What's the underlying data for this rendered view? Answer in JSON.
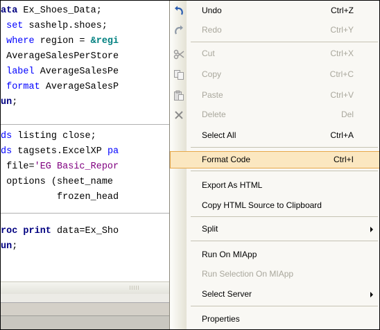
{
  "editor": {
    "lines": [
      [
        {
          "t": "ata",
          "c": "kwb"
        },
        {
          "t": " Ex_Shoes_Data;",
          "c": "plain"
        }
      ],
      [
        {
          "t": " set",
          "c": "kw"
        },
        {
          "t": " sashelp.shoes;",
          "c": "plain"
        }
      ],
      [
        {
          "t": " where",
          "c": "kw"
        },
        {
          "t": " region = ",
          "c": "plain"
        },
        {
          "t": "&regi",
          "c": "mac"
        }
      ],
      [
        {
          "t": " AverageSalesPerStore",
          "c": "plain"
        }
      ],
      [
        {
          "t": " label",
          "c": "kw"
        },
        {
          "t": " AverageSalesPe",
          "c": "plain"
        }
      ],
      [
        {
          "t": " format",
          "c": "kw"
        },
        {
          "t": " AverageSalesP",
          "c": "plain"
        }
      ],
      [
        {
          "t": "un",
          "c": "kwb"
        },
        {
          "t": ";",
          "c": "plain"
        }
      ],
      [
        {
          "t": "ds",
          "c": "kw"
        },
        {
          "t": " listing close;",
          "c": "plain"
        }
      ],
      [
        {
          "t": "ds",
          "c": "kw"
        },
        {
          "t": " tagsets.ExcelXP ",
          "c": "plain"
        },
        {
          "t": "pa",
          "c": "kw"
        }
      ],
      [
        {
          "t": " file=",
          "c": "plain"
        },
        {
          "t": "'EG Basic_Repor",
          "c": "str"
        }
      ],
      [
        {
          "t": " options (sheet_name ",
          "c": "plain"
        }
      ],
      [
        {
          "t": "          frozen_head",
          "c": "plain"
        }
      ],
      [
        {
          "t": "roc print",
          "c": "kwb"
        },
        {
          "t": " data=Ex_Sho",
          "c": "plain"
        }
      ],
      [
        {
          "t": "un",
          "c": "kwb"
        },
        {
          "t": ";",
          "c": "plain"
        }
      ]
    ]
  },
  "menu": {
    "items": [
      {
        "label": "Undo",
        "shortcut": "Ctrl+Z",
        "enabled": true,
        "icon": "undo-icon"
      },
      {
        "label": "Redo",
        "shortcut": "Ctrl+Y",
        "enabled": false,
        "icon": "redo-icon"
      },
      {
        "label": "Cut",
        "shortcut": "Ctrl+X",
        "enabled": false,
        "icon": "scissors-icon"
      },
      {
        "label": "Copy",
        "shortcut": "Ctrl+C",
        "enabled": false,
        "icon": "copy-icon"
      },
      {
        "label": "Paste",
        "shortcut": "Ctrl+V",
        "enabled": false,
        "icon": "paste-icon"
      },
      {
        "label": "Delete",
        "shortcut": "Del",
        "enabled": false,
        "icon": "delete-icon"
      },
      {
        "label": "Select All",
        "shortcut": "Ctrl+A",
        "enabled": true
      },
      {
        "label": "Format Code",
        "shortcut": "Ctrl+I",
        "enabled": true,
        "highlighted": true
      },
      {
        "label": "Export As HTML",
        "enabled": true
      },
      {
        "label": "Copy HTML Source to Clipboard",
        "enabled": true
      },
      {
        "label": "Split",
        "enabled": true,
        "submenu": true
      },
      {
        "label": "Run On MIApp",
        "enabled": true
      },
      {
        "label": "Run Selection On MIApp",
        "enabled": false
      },
      {
        "label": "Select Server",
        "enabled": true,
        "submenu": true
      },
      {
        "label": "Properties",
        "enabled": true
      }
    ]
  }
}
